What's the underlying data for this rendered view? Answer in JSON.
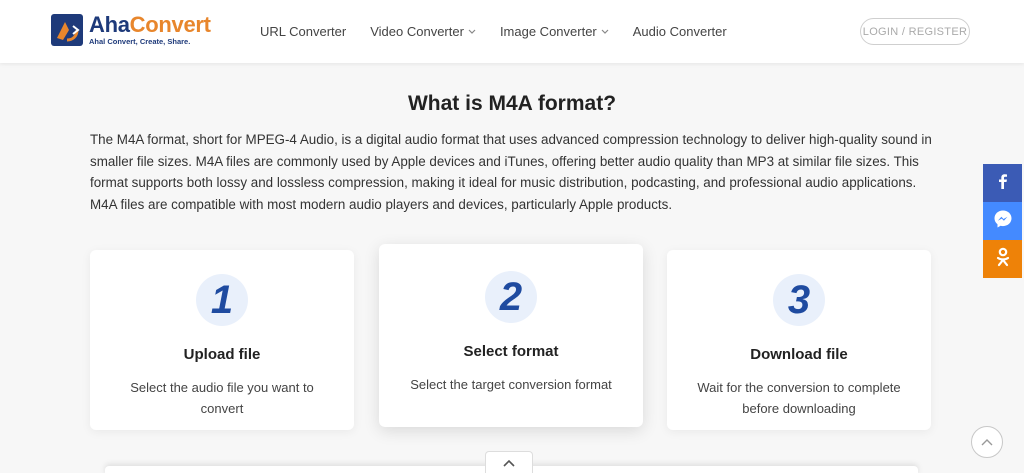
{
  "header": {
    "logo": {
      "name_part1": "Aha",
      "name_part2": "Convert",
      "tagline": "Ahal Convert, Create, Share."
    },
    "nav": [
      {
        "label": "URL Converter",
        "has_dropdown": false
      },
      {
        "label": "Video Converter",
        "has_dropdown": true
      },
      {
        "label": "Image Converter",
        "has_dropdown": true
      },
      {
        "label": "Audio Converter",
        "has_dropdown": false
      }
    ],
    "login_label": "LOGIN / REGISTER"
  },
  "main": {
    "heading": "What is M4A format?",
    "description": "The M4A format, short for MPEG-4 Audio, is a digital audio format that uses advanced compression technology to deliver high-quality sound in smaller file sizes. M4A files are commonly used by Apple devices and iTunes, offering better audio quality than MP3 at similar file sizes. This format supports both lossy and lossless compression, making it ideal for music distribution, podcasting, and professional audio applications. M4A files are compatible with most modern audio players and devices, particularly Apple products.",
    "steps": [
      {
        "number": "1",
        "title": "Upload file",
        "text": "Select the audio file you want to convert"
      },
      {
        "number": "2",
        "title": "Select format",
        "text": "Select the target conversion format"
      },
      {
        "number": "3",
        "title": "Download file",
        "text": "Wait for the conversion to complete before downloading"
      }
    ]
  },
  "share": [
    {
      "icon": "facebook-icon",
      "color": "#3b5bb5"
    },
    {
      "icon": "messenger-icon",
      "color": "#448aff"
    },
    {
      "icon": "odnoklassniki-icon",
      "color": "#ee8208"
    }
  ],
  "colors": {
    "brand_blue": "#1e3a7a",
    "brand_orange": "#e8862c",
    "step_number": "#1f4ba0"
  }
}
